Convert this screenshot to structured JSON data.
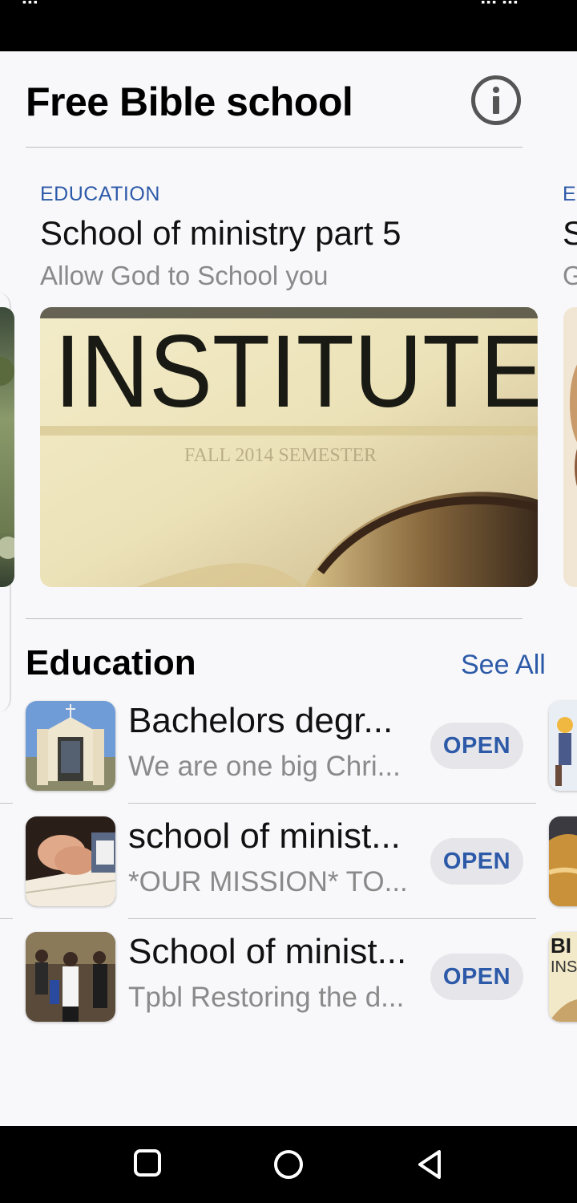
{
  "status_bar": {
    "left": "▪▪▪",
    "right": "▪▪▪ ▪▪▪"
  },
  "header": {
    "title": "Free Bible school",
    "info_icon": "info-icon"
  },
  "featured": {
    "category": "EDUCATION",
    "title": "School of ministry part 5",
    "subtitle": "Allow God to School you",
    "image_text": "INSTITUTE",
    "image_subtext": "FALL 2014 SEMESTER",
    "next_card": {
      "category": "E",
      "title": "S",
      "subtitle": "G"
    }
  },
  "section": {
    "title": "Education",
    "see_all_label": "See All"
  },
  "apps": [
    {
      "name": "Bachelors degr...",
      "description": "We are one big Chri...",
      "button_label": "OPEN"
    },
    {
      "name": "school of minist...",
      "description": "*OUR MISSION*  TO...",
      "button_label": "OPEN"
    },
    {
      "name": "School of minist...",
      "description": "Tpbl Restoring the d...",
      "button_label": "OPEN"
    }
  ],
  "peek_icon_text": {
    "line1": "BI",
    "line2": "INS"
  },
  "nav_bar": {
    "icons": [
      "recent-apps-icon",
      "home-icon",
      "back-icon"
    ]
  },
  "colors": {
    "accent": "#2d5aa8",
    "background": "#f8f8fa",
    "button_bg": "#e6e6ea"
  }
}
